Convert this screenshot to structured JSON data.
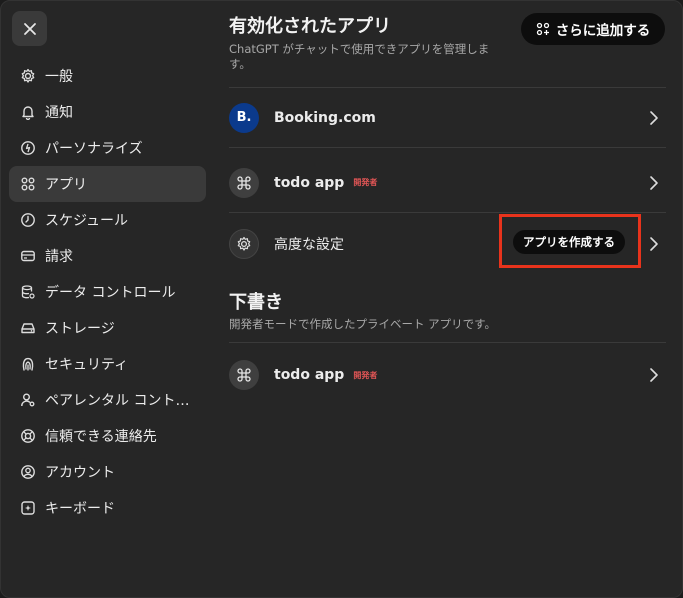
{
  "close_icon": "close-icon",
  "sidebar": {
    "items": [
      {
        "label": "一般",
        "icon": "gear-icon",
        "active": false
      },
      {
        "label": "通知",
        "icon": "bell-icon",
        "active": false
      },
      {
        "label": "パーソナライズ",
        "icon": "personalize-icon",
        "active": false
      },
      {
        "label": "アプリ",
        "icon": "apps-grid-icon",
        "active": true
      },
      {
        "label": "スケジュール",
        "icon": "clock-icon",
        "active": false
      },
      {
        "label": "請求",
        "icon": "credit-card-icon",
        "active": false
      },
      {
        "label": "データ コントロール",
        "icon": "database-icon",
        "active": false
      },
      {
        "label": "ストレージ",
        "icon": "storage-icon",
        "active": false
      },
      {
        "label": "セキュリティ",
        "icon": "security-icon",
        "active": false
      },
      {
        "label": "ペアレンタル コント…",
        "icon": "parental-icon",
        "active": false
      },
      {
        "label": "信頼できる連絡先",
        "icon": "lifebuoy-icon",
        "active": false
      },
      {
        "label": "アカウント",
        "icon": "account-icon",
        "active": false
      },
      {
        "label": "キーボード",
        "icon": "keyboard-icon",
        "active": false
      }
    ]
  },
  "main": {
    "title": "有効化されたアプリ",
    "subtitle": "ChatGPT がチャットで使用できアプリを管理します。",
    "add_button": "さらに追加する",
    "apps": [
      {
        "name": "Booking.com",
        "avatar_text": "B.",
        "avatar_color": "#0b3a8c",
        "badge": ""
      },
      {
        "name": "todo app",
        "avatar_text": "",
        "avatar_color": "#3f3f3f",
        "badge": "開発者"
      }
    ],
    "advanced": {
      "label": "高度な設定",
      "create_button": "アプリを作成する"
    },
    "drafts": {
      "title": "下書き",
      "subtitle": "開発者モードで作成したプライベート アプリです。",
      "items": [
        {
          "name": "todo app",
          "badge": "開発者"
        }
      ]
    }
  },
  "colors": {
    "background": "#262626",
    "active_item": "#3a3a3a",
    "badge_red": "#e05555",
    "highlight_red": "#e8331c",
    "booking_blue": "#0b3a8c"
  }
}
